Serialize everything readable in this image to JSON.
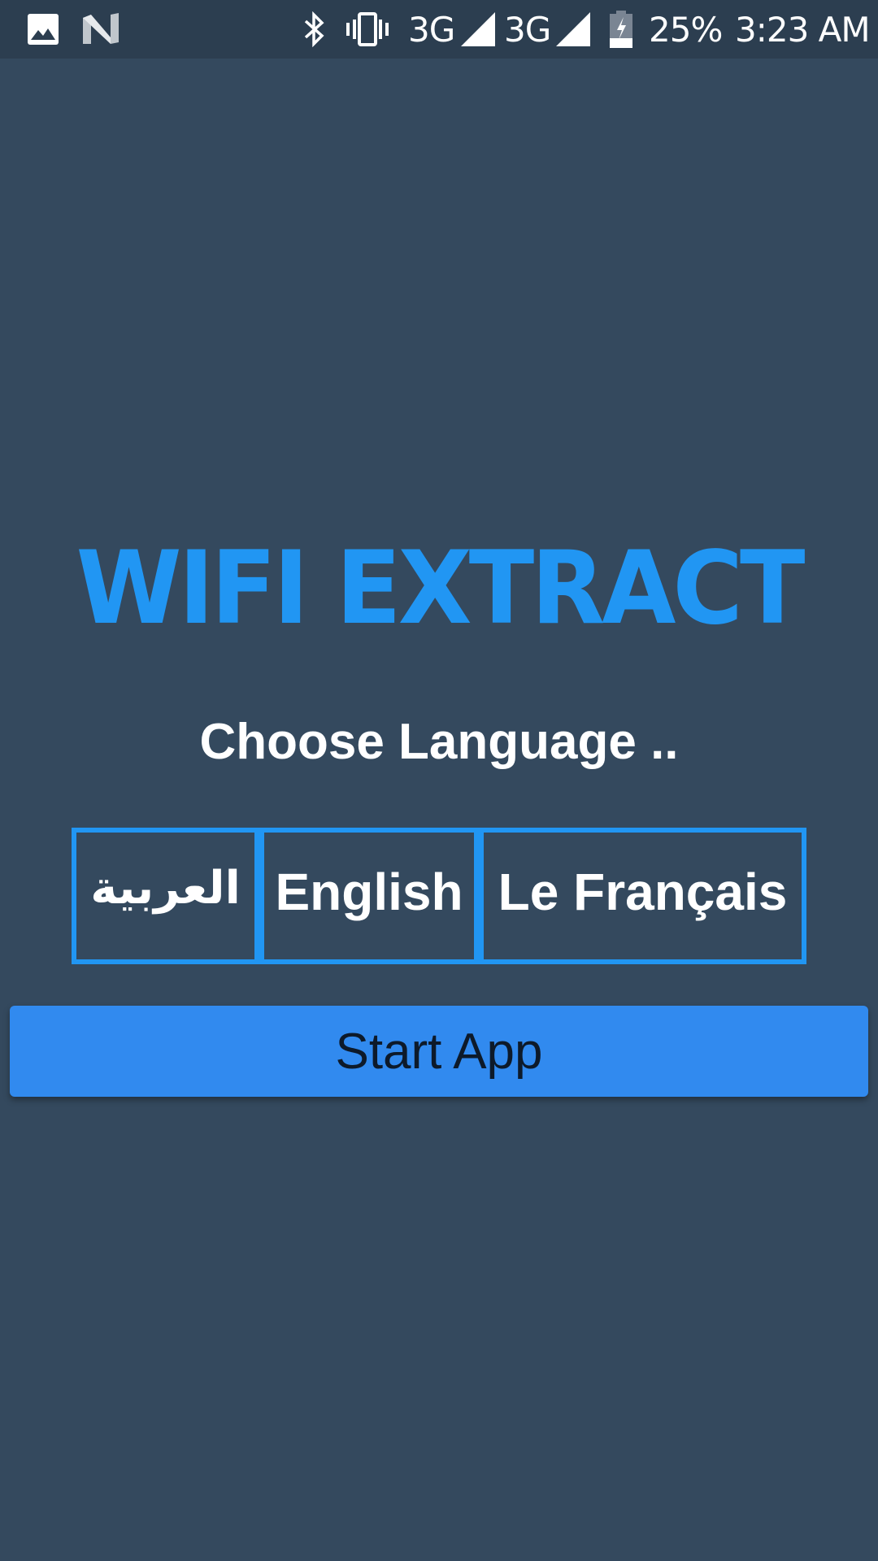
{
  "status_bar": {
    "left_icons": [
      "gallery-notification-icon",
      "android-n-icon"
    ],
    "right_icons": [
      "bluetooth-icon",
      "vibrate-icon",
      "signal-icon",
      "signal-icon",
      "battery-charging-icon"
    ],
    "network_1": "3G",
    "network_2": "3G",
    "battery": "25%",
    "time": "3:23 AM"
  },
  "app": {
    "title": "WIFI EXTRACT",
    "subtitle": "Choose Language ..",
    "languages": [
      {
        "label": "العربية",
        "code": "ar"
      },
      {
        "label": "English",
        "code": "en"
      },
      {
        "label": "Le Français",
        "code": "fr"
      }
    ],
    "start_button": "Start App"
  },
  "colors": {
    "background": "#34495e",
    "status_bar": "#2c3e50",
    "accent": "#2196f3",
    "button": "#318aef"
  }
}
